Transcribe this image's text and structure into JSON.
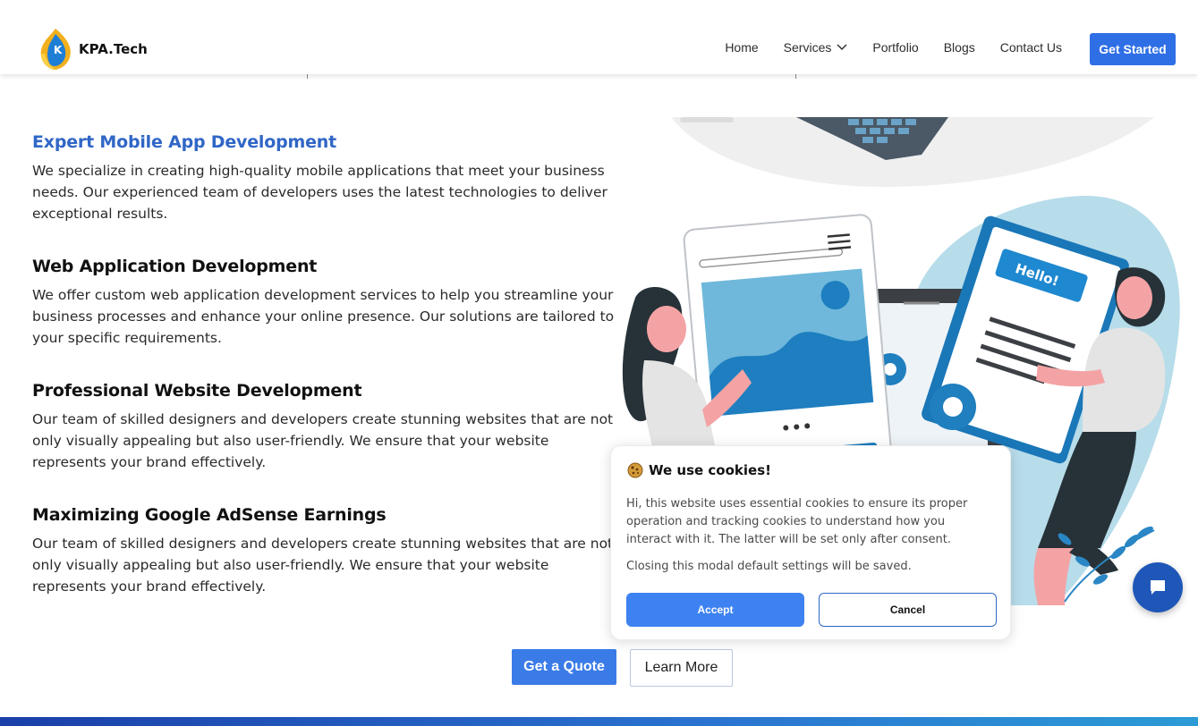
{
  "brand": {
    "name": "KPA.Tech"
  },
  "nav": {
    "items": [
      "Home",
      "Services",
      "Portfolio",
      "Blogs",
      "Contact Us"
    ],
    "cta": "Get Started"
  },
  "sections": [
    {
      "title": "Expert Mobile App Development",
      "text": "We specialize in creating high-quality mobile applications that meet your business needs. Our experienced team of developers uses the latest technologies to deliver exceptional results."
    },
    {
      "title": "Web Application Development",
      "text": "We offer custom web application development services to help you streamline your business processes and enhance your online presence. Our solutions are tailored to your specific requirements."
    },
    {
      "title": "Professional Website Development",
      "text": "Our team of skilled designers and developers create stunning websites that are not only visually appealing but also user-friendly. We ensure that your website represents your brand effectively."
    },
    {
      "title": "Maximizing Google AdSense Earnings",
      "text": "Our team of skilled designers and developers create stunning websites that are not only visually appealing but also user-friendly. We ensure that your website represents your brand effectively."
    }
  ],
  "actions": {
    "quote": "Get a Quote",
    "learn": "Learn More"
  },
  "illustration": {
    "bubble_text": "Hello!"
  },
  "cookie": {
    "title": "We use cookies!",
    "text": "Hi, this website uses essential cookies to ensure its proper operation and tracking cookies to understand how you interact with it. The latter will be set only after consent.",
    "note": "Closing this modal default settings will be saved.",
    "accept": "Accept",
    "cancel": "Cancel"
  },
  "colors": {
    "primary": "#2f6fe6",
    "accent_heading": "#3066c6",
    "chat": "#1f57b8"
  }
}
